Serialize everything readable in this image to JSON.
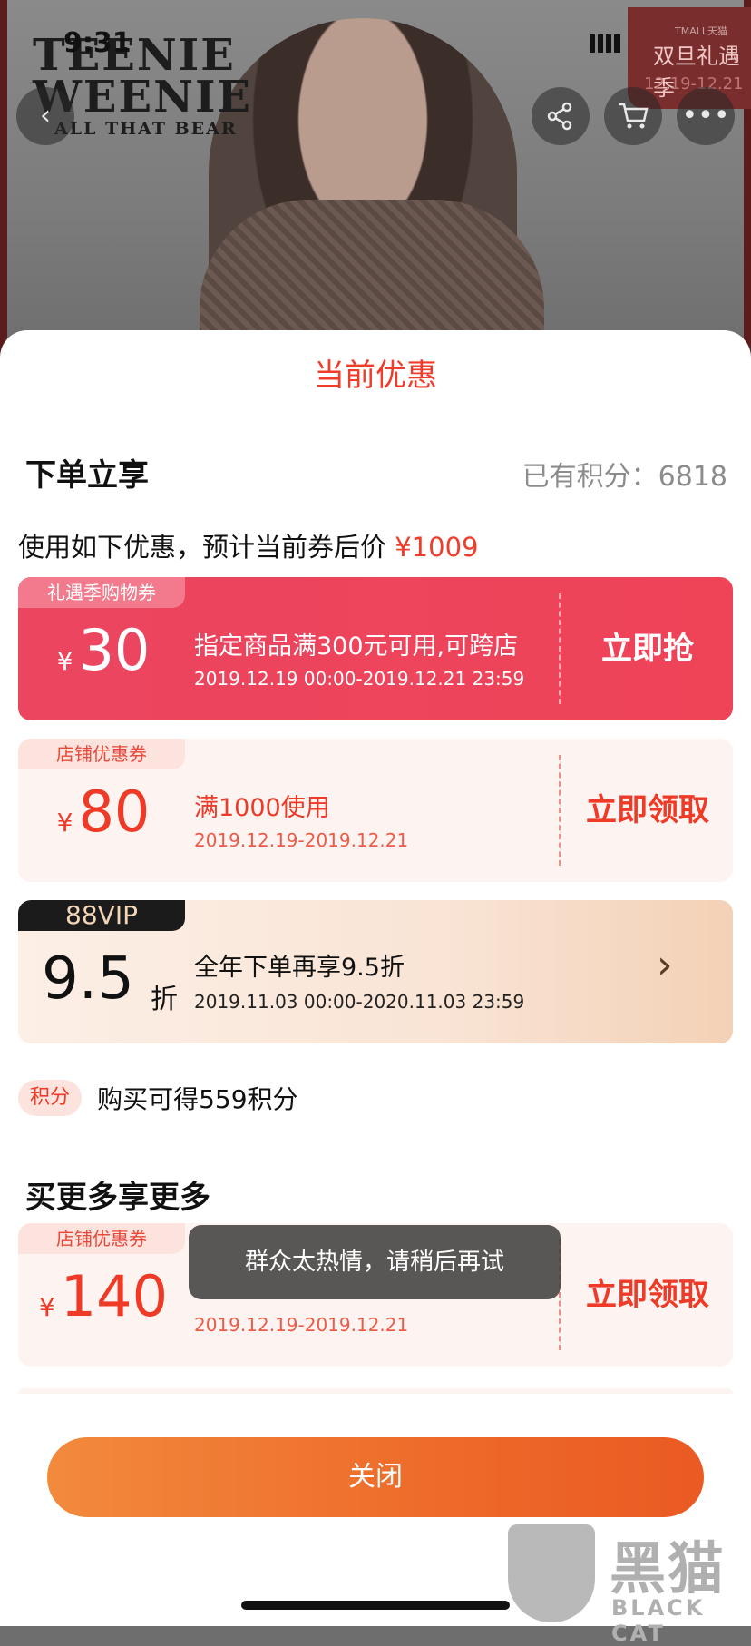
{
  "status_bar": {
    "time": "9:31"
  },
  "header": {
    "brand_line1": "TEENIE",
    "brand_line2": "WEENIE",
    "brand_line3": "ALL THAT BEAR",
    "badge_small": "TMALL天猫",
    "badge_name": "双旦礼遇季",
    "badge_date": "12.19-12.21",
    "back_icon": "chevron-left-icon",
    "share_icon": "share-icon",
    "cart_icon": "cart-icon",
    "more_icon": "more-icon"
  },
  "sheet": {
    "title": "当前优惠",
    "section1_title": "下单立享",
    "points_text": "已有积分：6818",
    "estimate_text": "使用如下优惠，预计当前券后价",
    "estimate_price": "¥1009",
    "coupons": [
      {
        "tag": "礼遇季购物券",
        "currency": "¥",
        "amount": "30",
        "condition": "指定商品满300元可用,可跨店",
        "period": "2019.12.19 00:00-2019.12.21 23:59",
        "cta": "立即抢"
      },
      {
        "tag": "店铺优惠券",
        "currency": "¥",
        "amount": "80",
        "condition": "满1000使用",
        "period": "2019.12.19-2019.12.21",
        "cta": "立即领取"
      }
    ],
    "vip": {
      "tag": "88VIP",
      "discount": "9.5",
      "unit": "折",
      "condition": "全年下单再享9.5折",
      "period": "2019.11.03 00:00-2020.11.03 23:59"
    },
    "earn_pill": "积分",
    "earn_text": "购买可得559积分",
    "section2_title": "买更多享更多",
    "more_coupon": {
      "tag": "店铺优惠券",
      "currency": "¥",
      "amount": "140",
      "period": "2019.12.19-2019.12.21",
      "cta": "立即领取"
    },
    "toast": "群众太热情，请稍后再试",
    "close_label": "关闭"
  },
  "watermark": {
    "cn": "黑猫",
    "en": "BLACK CAT"
  },
  "colors": {
    "accent_red": "#f03c2a",
    "coupon_red": "#ec4560",
    "close_orange": "#ee6a2a"
  }
}
